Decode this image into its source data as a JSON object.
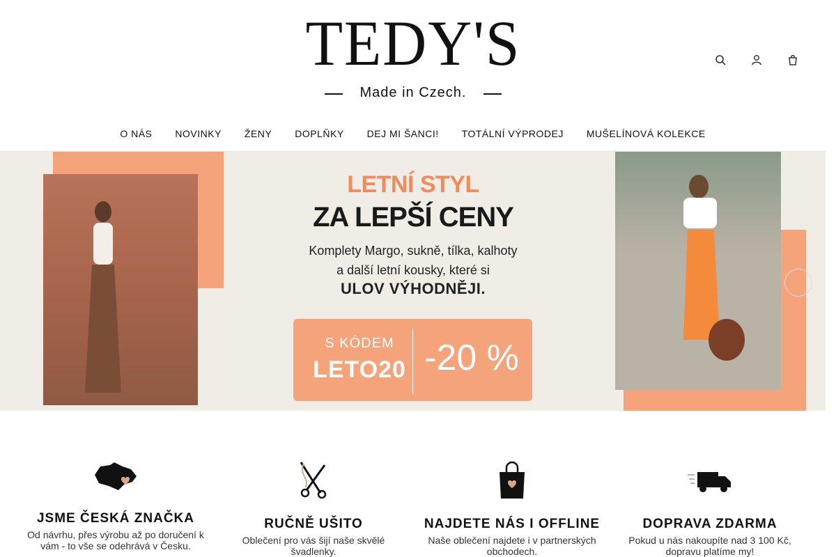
{
  "brand": {
    "logo_main": "TEDY'S",
    "logo_sub": "Made in Czech."
  },
  "header_icons": [
    "search-icon",
    "user-icon",
    "cart-icon"
  ],
  "nav": {
    "items": [
      "O NÁS",
      "NOVINKY",
      "ŽENY",
      "DOPLŇKY",
      "DEJ MI ŠANCI!",
      "TOTÁLNÍ VÝPRODEJ",
      "MUŠELÍNOVÁ KOLEKCE"
    ]
  },
  "banner": {
    "headline1": "LETNÍ STYL",
    "headline2": "ZA LEPŠÍ CENY",
    "body_line1": "Komplety Margo, sukně, tílka, kalhoty",
    "body_line2": "a další letní kousky, které si",
    "body_strong": "ULOV VÝHODNĚJI.",
    "code_label": "S KÓDEM",
    "code_value": "LETO20",
    "discount": "-20 %",
    "colors": {
      "accent": "#f5a37a",
      "headline": "#f28a59",
      "background": "#f0ece6"
    }
  },
  "features": [
    {
      "icon": "czech-map-heart-icon",
      "title": "JSME ČESKÁ ZNAČKA",
      "desc": "Od návrhu, přes výrobu až po doručení k vám - to vše se odehrává v Česku."
    },
    {
      "icon": "scissors-needle-icon",
      "title": "RUČNĚ UŠITO",
      "desc": "Oblečení pro vás šijí naše skvělé švadlenky."
    },
    {
      "icon": "shopping-bag-heart-icon",
      "title": "NAJDETE NÁS I OFFLINE",
      "desc": "Naše oblečení najdete i v partnerských obchodech."
    },
    {
      "icon": "delivery-truck-icon",
      "title": "DOPRAVA ZDARMA",
      "desc": "Pokud u nás nakoupíte nad 3 100 Kč, dopravu platíme my!"
    }
  ]
}
